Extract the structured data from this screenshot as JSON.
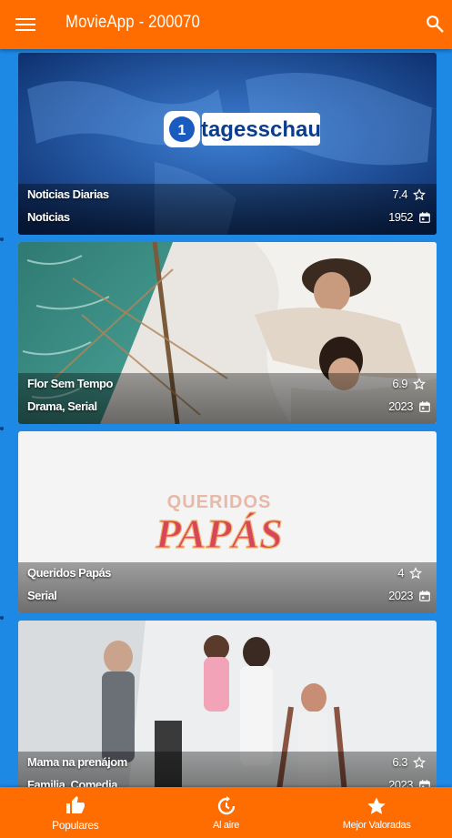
{
  "app": {
    "title": "MovieApp - 200070"
  },
  "movies": [
    {
      "title": "Noticias Diarias",
      "genre": "Noticias",
      "rating": "7.4",
      "year": "1952",
      "art_text": "tagesschau"
    },
    {
      "title": "Flor Sem Tempo",
      "genre": "Drama, Serial",
      "rating": "6.9",
      "year": "2023"
    },
    {
      "title": "Queridos Papás",
      "genre": "Serial",
      "rating": "4",
      "year": "2023",
      "art_text_top": "QUERIDOS",
      "art_text_main": "PAPÁS"
    },
    {
      "title": "Mama na prenájom",
      "genre": "Familia, Comedia",
      "rating": "6.3",
      "year": "2023"
    }
  ],
  "nav": {
    "tabs": [
      {
        "label": "Populares",
        "icon": "thumb-up-icon"
      },
      {
        "label": "Al aire",
        "icon": "refresh-icon"
      },
      {
        "label": "Mejor Valoradas",
        "icon": "star-icon"
      }
    ]
  },
  "colors": {
    "appbar": "#ff6d00",
    "background": "#1e88e5"
  }
}
